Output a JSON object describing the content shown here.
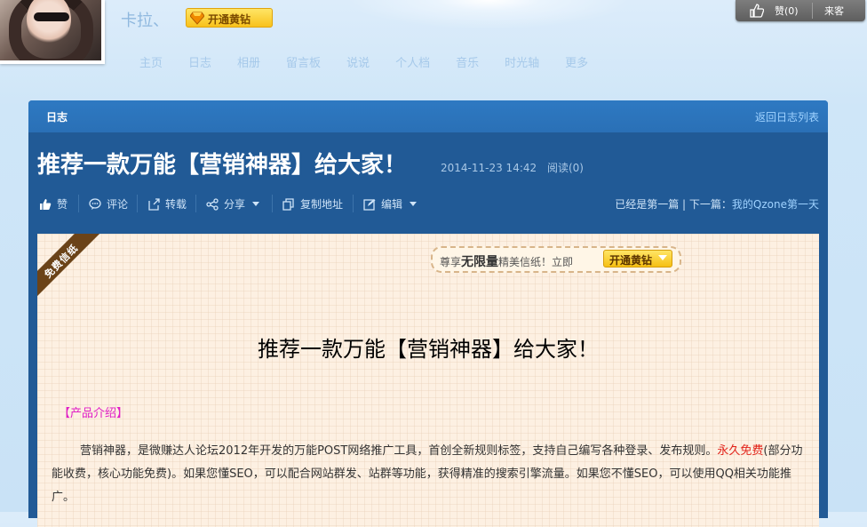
{
  "header": {
    "nickname": "卡拉、",
    "vip_button": "开通黄钻",
    "nav": [
      "主页",
      "日志",
      "相册",
      "留言板",
      "说说",
      "个人档",
      "音乐",
      "时光轴",
      "更多"
    ],
    "like_label": "赞(0)",
    "share_label": "来客"
  },
  "panel": {
    "title": "日志",
    "back_link": "返回日志列表",
    "article_title": "推荐一款万能【营销神器】给大家！",
    "date": "2014-11-23 14:42",
    "reads": "阅读(0)",
    "tools": {
      "like": "赞",
      "comment": "评论",
      "repost": "转载",
      "share": "分享",
      "copy": "复制地址",
      "edit": "编辑"
    },
    "first_post": "已经是第一篇",
    "next_prefix": "下一篇：",
    "next_title": "我的Qzone第一天"
  },
  "content": {
    "ribbon": "免费信纸",
    "promo_prefix": "尊享",
    "promo_strong": "无限量",
    "promo_suffix": "精美信纸！立即",
    "promo_button": "开通黄钻",
    "title": "推荐一款万能【营销神器】给大家！",
    "section": "【产品介绍】",
    "para_1": "营销神器，是微赚达人论坛2012年开发的万能POST网络推广工具，首创全新规则标签，支持自己编写各种登录、发布规则。",
    "para_red": "永久免费",
    "para_2": "(部分功能收费，核心功能免费)。如果您懂SEO，可以配合网站群发、站群等功能，获得精准的搜索引擎流量。如果您不懂SEO，可以使用QQ相关功能推广。"
  },
  "colors": {
    "panel": "#215a96",
    "panel_header": "#2e79c2",
    "paper": "#fdf0e2",
    "accent_yellow": "#f8c21c",
    "section_magenta": "#e01ec6",
    "highlight_red": "#e2231a"
  }
}
